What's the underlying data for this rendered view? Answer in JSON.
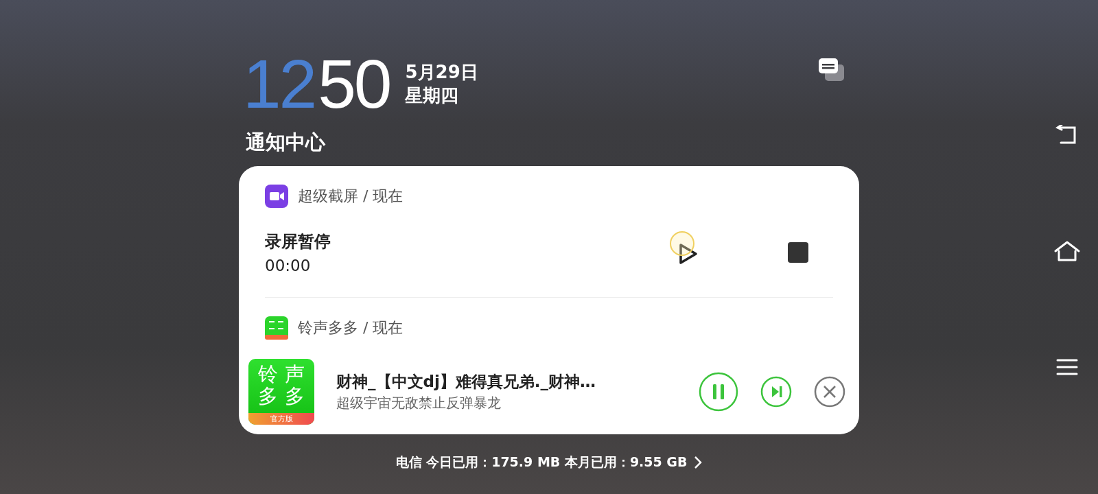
{
  "clock": {
    "hour": "12",
    "minute": "50",
    "date": "5月29日",
    "weekday": "星期四"
  },
  "header": {
    "title": "通知中心"
  },
  "notifications": [
    {
      "kind": "recorder",
      "app": "超级截屏 / 现在",
      "title": "录屏暂停",
      "timer": "00:00"
    },
    {
      "kind": "music",
      "app": "铃声多多 / 现在",
      "cover_lines": [
        "铃声",
        "多多"
      ],
      "cover_badge": "官方版",
      "song": "财神_【中文dj】难得真兄弟._财神…",
      "artist": "超级宇宙无敌禁止反弹暴龙"
    }
  ],
  "status_bar": {
    "data_usage": "电信 今日已用：175.9 MB 本月已用：9.55 GB"
  }
}
